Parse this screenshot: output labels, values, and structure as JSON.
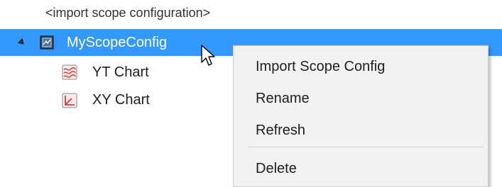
{
  "tree": {
    "import_placeholder": "<import scope configuration>",
    "root": {
      "label": "MyScopeConfig",
      "icon": "scope-config-icon",
      "expanded": true,
      "selected": true
    },
    "children": [
      {
        "label": "YT Chart",
        "icon": "yt-chart-icon"
      },
      {
        "label": "XY Chart",
        "icon": "xy-chart-icon"
      }
    ]
  },
  "context_menu": {
    "items": [
      {
        "label": "Import Scope Config"
      },
      {
        "label": "Rename"
      },
      {
        "label": "Refresh"
      },
      {
        "label": "Delete"
      }
    ]
  },
  "colors": {
    "selection": "#3399ff",
    "menu_background": "#f2f2f2",
    "chart_red": "#d83a3a"
  }
}
